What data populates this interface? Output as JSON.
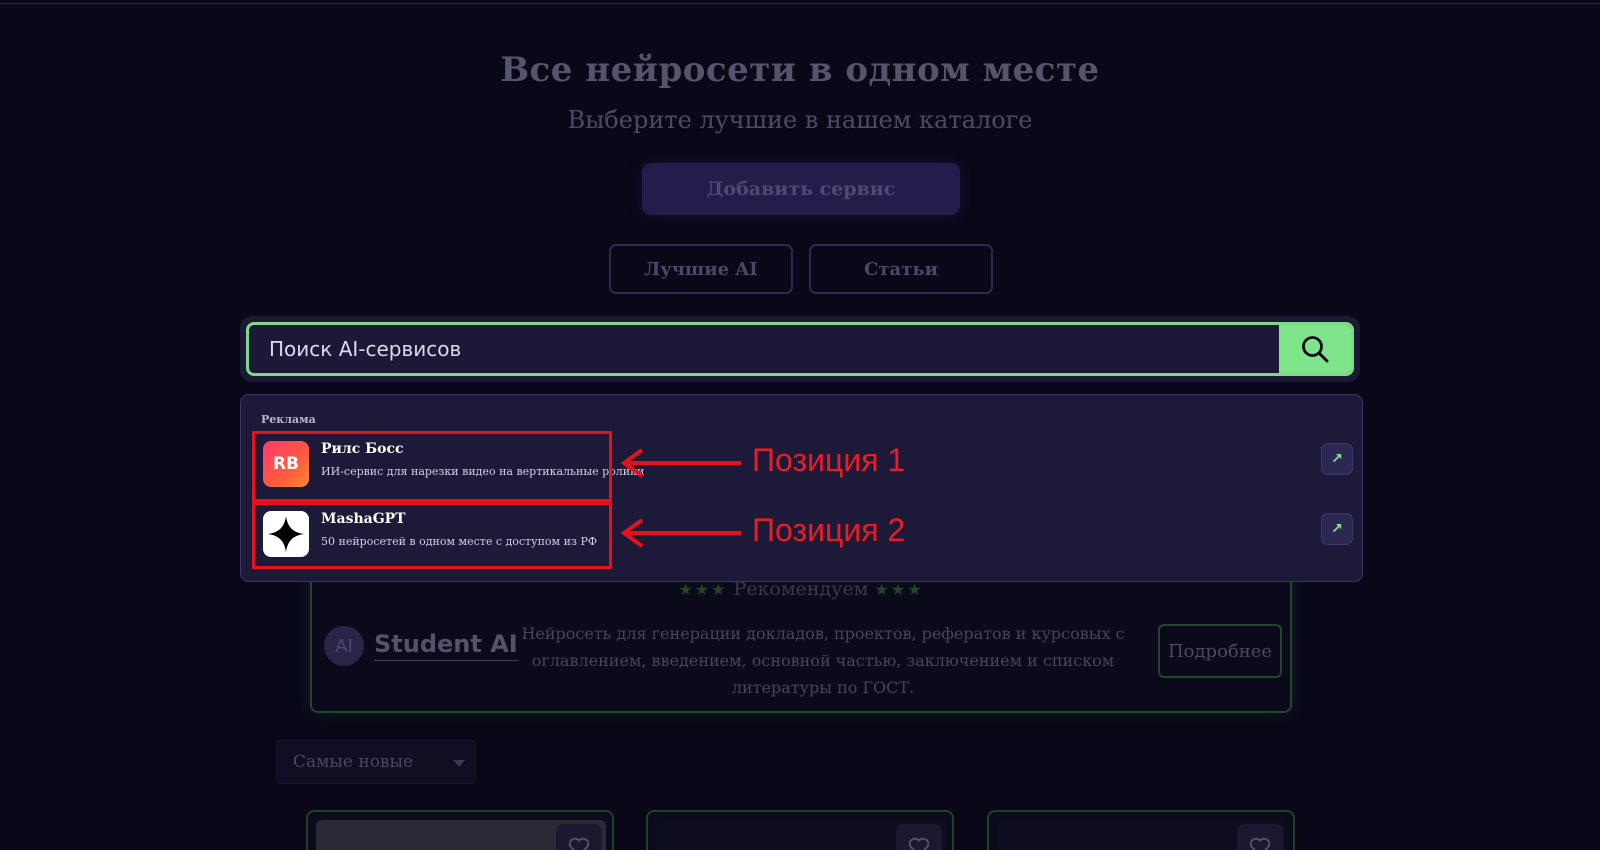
{
  "hero": {
    "title": "Все нейросети в одном месте",
    "subtitle": "Выберите лучшие в нашем каталоге",
    "add_button": "Добавить сервис"
  },
  "nav": {
    "best": "Лучшие AI",
    "articles": "Статьи"
  },
  "search": {
    "placeholder": "Поиск AI-сервисов",
    "button_icon": "search-icon"
  },
  "dropdown": {
    "label": "Реклама",
    "items": [
      {
        "logo_text": "RB",
        "name": "Рилс Босс",
        "description": "ИИ-сервис для нарезки видео на вертикальные ролики",
        "action_icon": "external-arrow-icon"
      },
      {
        "logo_icon": "four-point-star-icon",
        "name": "MashaGPT",
        "description": "50 нейросетей в одном месте с доступом из РФ",
        "action_icon": "external-arrow-icon"
      }
    ]
  },
  "annotations": {
    "position1": "Позиция 1",
    "position2": "Позиция 2",
    "color": "#e8101c"
  },
  "recommended": {
    "stars": "★★★",
    "title": "Рекомендуем",
    "logo_text": "AI",
    "name": "Student AI",
    "description": "Нейросеть для генерации докладов, проектов, рефератов и курсовых с оглавлением, введением, основной частью, заключением и списком литературы по ГОСТ.",
    "more_button": "Подробнее"
  },
  "sort": {
    "selected": "Самые новые"
  },
  "colors": {
    "accent_green": "#7fe58a",
    "background": "#0a0818",
    "dropdown_bg": "#1c1a38"
  }
}
